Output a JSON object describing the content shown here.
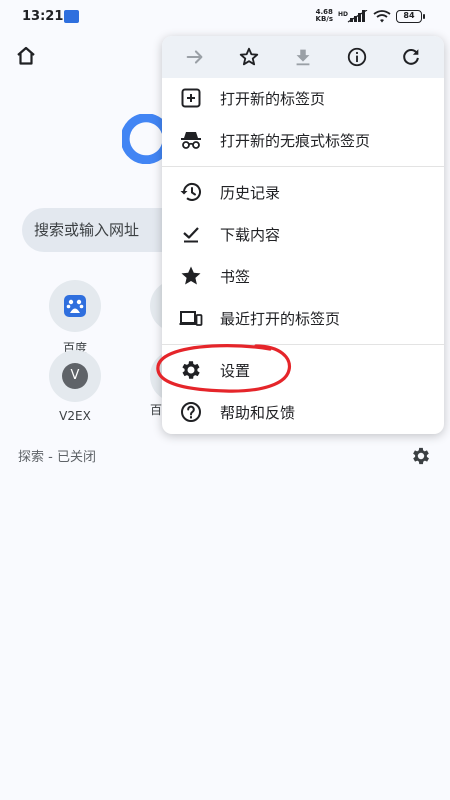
{
  "status_bar": {
    "time": "13:21",
    "speed_value": "4.68",
    "speed_unit": "KB/s",
    "battery": "84"
  },
  "page": {
    "search_placeholder": "搜索或输入网址",
    "tiles": [
      {
        "label": "百度"
      },
      {
        "label": "V2EX",
        "badge": "V"
      }
    ],
    "partial_tile_label": "百",
    "discover_label": "探索 - 已关闭"
  },
  "menu": {
    "toolbar": [
      {
        "name": "forward-icon"
      },
      {
        "name": "star-outline-icon"
      },
      {
        "name": "download-icon"
      },
      {
        "name": "info-icon"
      },
      {
        "name": "refresh-icon"
      }
    ],
    "items": [
      {
        "label": "打开新的标签页",
        "icon": "add-box-icon"
      },
      {
        "label": "打开新的无痕式标签页",
        "icon": "incognito-icon"
      },
      {
        "label": "历史记录",
        "icon": "history-icon"
      },
      {
        "label": "下载内容",
        "icon": "download-done-icon"
      },
      {
        "label": "书签",
        "icon": "star-icon"
      },
      {
        "label": "最近打开的标签页",
        "icon": "devices-icon"
      },
      {
        "label": "设置",
        "icon": "settings-icon"
      },
      {
        "label": "帮助和反馈",
        "icon": "help-icon"
      }
    ]
  },
  "colors": {
    "annotation": "#e5252a",
    "background": "#f9fafe",
    "toolbar_bg": "#edf1f6"
  }
}
